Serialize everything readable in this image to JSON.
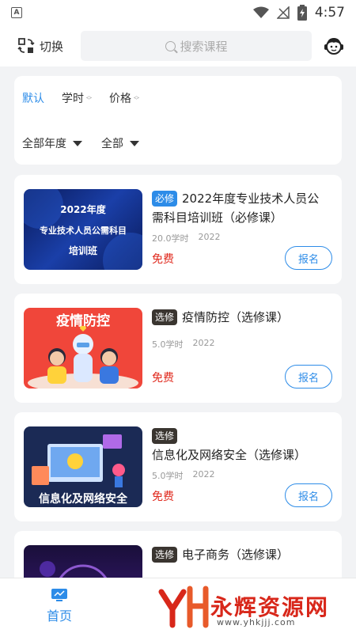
{
  "status_bar": {
    "time": "4:57",
    "app_icon": "A"
  },
  "header": {
    "switch_label": "切换",
    "search_placeholder": "搜索课程"
  },
  "filters": {
    "sort": [
      {
        "label": "默认",
        "active": true
      },
      {
        "label": "学时",
        "active": false
      },
      {
        "label": "价格",
        "active": false
      }
    ],
    "dropdowns": [
      "全部年度",
      "全部"
    ]
  },
  "courses": [
    {
      "tag": "必修",
      "title": "2022年度专业技术人员公需科目培训班（必修课）",
      "hours": "20.0学时",
      "year": "2022",
      "price": "免费",
      "button": "报名",
      "thumb_lines": [
        "2022年度",
        "专业技术人员公需科目",
        "培训班"
      ]
    },
    {
      "tag": "选修",
      "title": "疫情防控（选修课）",
      "hours": "5.0学时",
      "year": "2022",
      "price": "免费",
      "button": "报名",
      "thumb_lines": [
        "疫情防控"
      ]
    },
    {
      "tag": "选修",
      "title": "信息化及网络安全（选修课）",
      "hours": "5.0学时",
      "year": "2022",
      "price": "免费",
      "button": "报名",
      "thumb_lines": [
        "信息化及网络安全"
      ]
    },
    {
      "tag": "选修",
      "title": "电子商务（选修课）",
      "hours": "",
      "year": "",
      "price": "",
      "button": "",
      "thumb_lines": []
    }
  ],
  "tabbar": {
    "home_label": "首页"
  },
  "watermark": {
    "text": "永辉资源网",
    "url": "www.yhkjjj.com"
  },
  "colors": {
    "accent": "#2d8ce8",
    "price": "#e02a1e",
    "required_tag": "#2d8ce8",
    "elective_tag": "#3a3530"
  }
}
